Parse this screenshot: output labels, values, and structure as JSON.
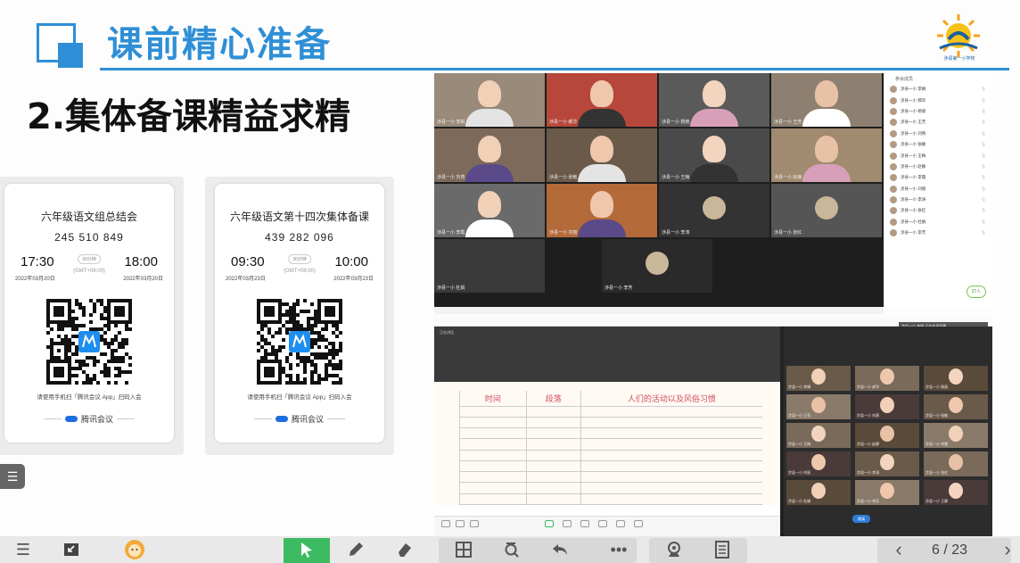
{
  "header": {
    "title": "课前精心准备",
    "logo_text": "涉县第一小学校"
  },
  "subtitle": "2.集体备课精益求精",
  "cards": [
    {
      "title": "六年级语文组总结会",
      "meeting_id": "245 510 849",
      "start_time": "17:30",
      "end_time": "18:00",
      "duration": "30分钟",
      "timezone": "(GMT+08:00)",
      "start_date": "2022年03月20日",
      "end_date": "2022年03月20日",
      "hint": "请使用手机扫「腾讯会议 App」扫码入会",
      "brand": "腾讯会议"
    },
    {
      "title": "六年级语文第十四次集体备课",
      "meeting_id": "439 282 096",
      "start_time": "09:30",
      "end_time": "10:00",
      "duration": "30分钟",
      "timezone": "(GMT+08:00)",
      "start_date": "2022年03月23日",
      "end_date": "2022年03月23日",
      "hint": "请使用手机扫「腾讯会议 App」扫码入会",
      "brand": "腾讯会议"
    }
  ],
  "meeting1": {
    "tiles": [
      {
        "name": "涉县一小 李娟"
      },
      {
        "name": "涉县一小 郝华"
      },
      {
        "name": "涉县一小 杨丽"
      },
      {
        "name": "涉县一小 王芳"
      },
      {
        "name": "涉县一小 刘燕"
      },
      {
        "name": "涉县一小 张敏"
      },
      {
        "name": "涉县一小 王梅"
      },
      {
        "name": "涉县一小 赵静"
      },
      {
        "name": "涉县一小 李霞"
      },
      {
        "name": "涉县一小 刘丽"
      },
      {
        "name": "涉县一小 李涛"
      },
      {
        "name": "涉县一小 张红"
      },
      {
        "name": "涉县一小 杜娟"
      },
      {
        "name": "涉县一小 李芳"
      }
    ],
    "participants_header": "参会成员",
    "participants": [
      "涉县一小 李娟",
      "涉县一小 郝华",
      "涉县一小 杨丽",
      "涉县一小 王芳",
      "涉县一小 刘燕",
      "涉县一小 张敏",
      "涉县一小 王梅",
      "涉县一小 赵静",
      "涉县一小 李霞",
      "涉县一小 刘丽",
      "涉县一小 李涛",
      "涉县一小 张红",
      "涉县一小 杜娟",
      "涉县一小 李芳"
    ],
    "count": "27人"
  },
  "meeting2": {
    "top_label": "正在讲话",
    "table_headers": [
      "时间",
      "段落",
      "人们的活动以及风俗习惯"
    ],
    "grid_tiles": [
      {
        "name": "涉县一小 李娟"
      },
      {
        "name": "涉县一小 郝华"
      },
      {
        "name": "涉县一小 杨丽"
      },
      {
        "name": "涉县一小 王芳"
      },
      {
        "name": "涉县一小 刘燕"
      },
      {
        "name": "涉县一小 张敏"
      },
      {
        "name": "涉县一小 王梅"
      },
      {
        "name": "涉县一小 赵静"
      },
      {
        "name": "涉县一小 李霞"
      },
      {
        "name": "涉县一小 刘丽"
      },
      {
        "name": "涉县一小 李涛"
      },
      {
        "name": "涉县一小 张红"
      },
      {
        "name": "涉县一小 杜娟"
      },
      {
        "name": "涉县一小 李芳"
      },
      {
        "name": "涉县一小 王静"
      }
    ],
    "pill": "邀请",
    "tooltip": "涉县一小 李娟 正在共享屏幕"
  },
  "toolbar": {
    "page": "6 / 23"
  }
}
